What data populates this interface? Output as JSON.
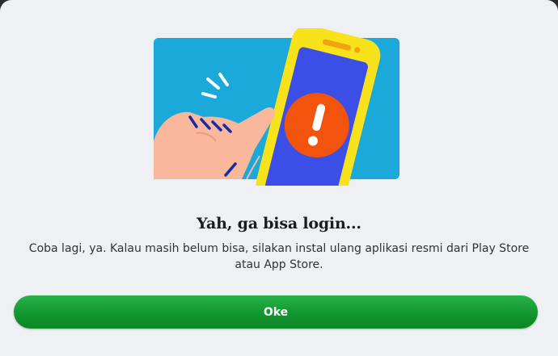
{
  "dialog": {
    "illustration_icon": "phone-error-illustration",
    "title": "Yah, ga bisa login...",
    "message": "Coba lagi, ya. Kalau masih belum bisa, silakan instal ulang aplikasi resmi dari Play Store atau App Store.",
    "ok_label": "Oke"
  },
  "colors": {
    "background": "#eff0f3",
    "illustration_bg": "#1aa9d8",
    "phone_frame": "#f7e21c",
    "phone_screen": "#3b4ee6",
    "alert_circle": "#f2540d",
    "hand": "#f9b89c",
    "button": "#12962f"
  }
}
